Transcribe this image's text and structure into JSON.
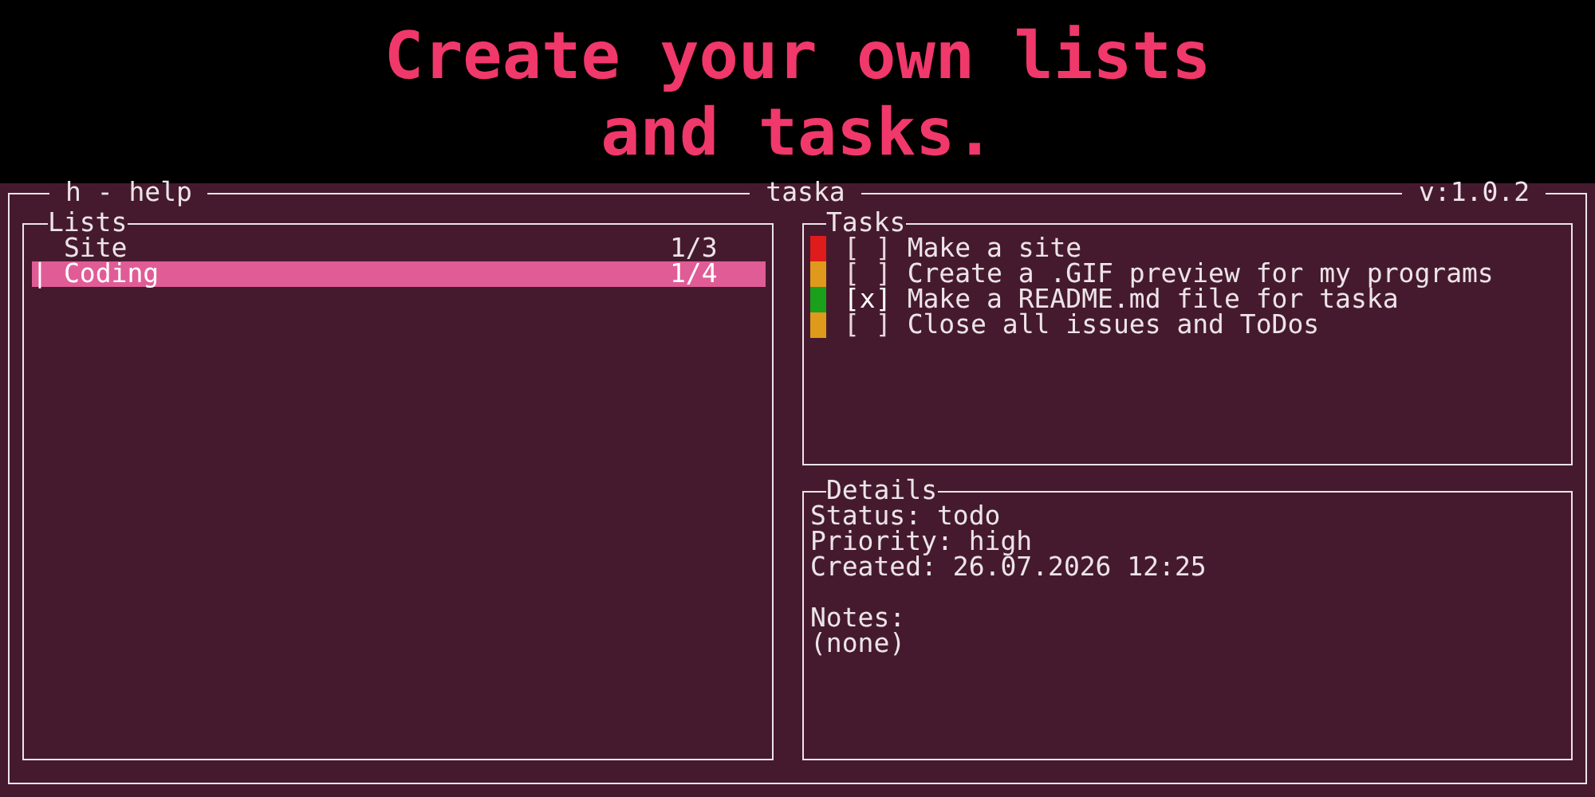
{
  "headline": [
    "Create your own lists",
    "and tasks."
  ],
  "header": {
    "help": "h - help",
    "title": "taska",
    "version": "v:1.0.2"
  },
  "lists": {
    "title": "Lists",
    "items": [
      {
        "marker": "",
        "name": "Site",
        "count": "1/3",
        "selected": false
      },
      {
        "marker": "|",
        "name": "Coding",
        "count": "1/4",
        "selected": true
      }
    ]
  },
  "tasks": {
    "title": "Tasks",
    "items": [
      {
        "color": "#e01b1b",
        "checkbox": "[ ]",
        "checked": false,
        "text": "Make a site"
      },
      {
        "color": "#e09a1b",
        "checkbox": "[ ]",
        "checked": false,
        "text": "Create a .GIF preview for my programs"
      },
      {
        "color": "#1ba01b",
        "checkbox": "[x]",
        "checked": true,
        "text": "Make a README.md file for taska"
      },
      {
        "color": "#e09a1b",
        "checkbox": "[ ]",
        "checked": false,
        "text": "Close all issues and ToDos"
      }
    ]
  },
  "details": {
    "title": "Details",
    "lines": [
      "Status: todo",
      "Priority: high",
      "Created: 26.07.2026 12:25"
    ],
    "notes_label": "Notes:",
    "notes": "(none)"
  }
}
